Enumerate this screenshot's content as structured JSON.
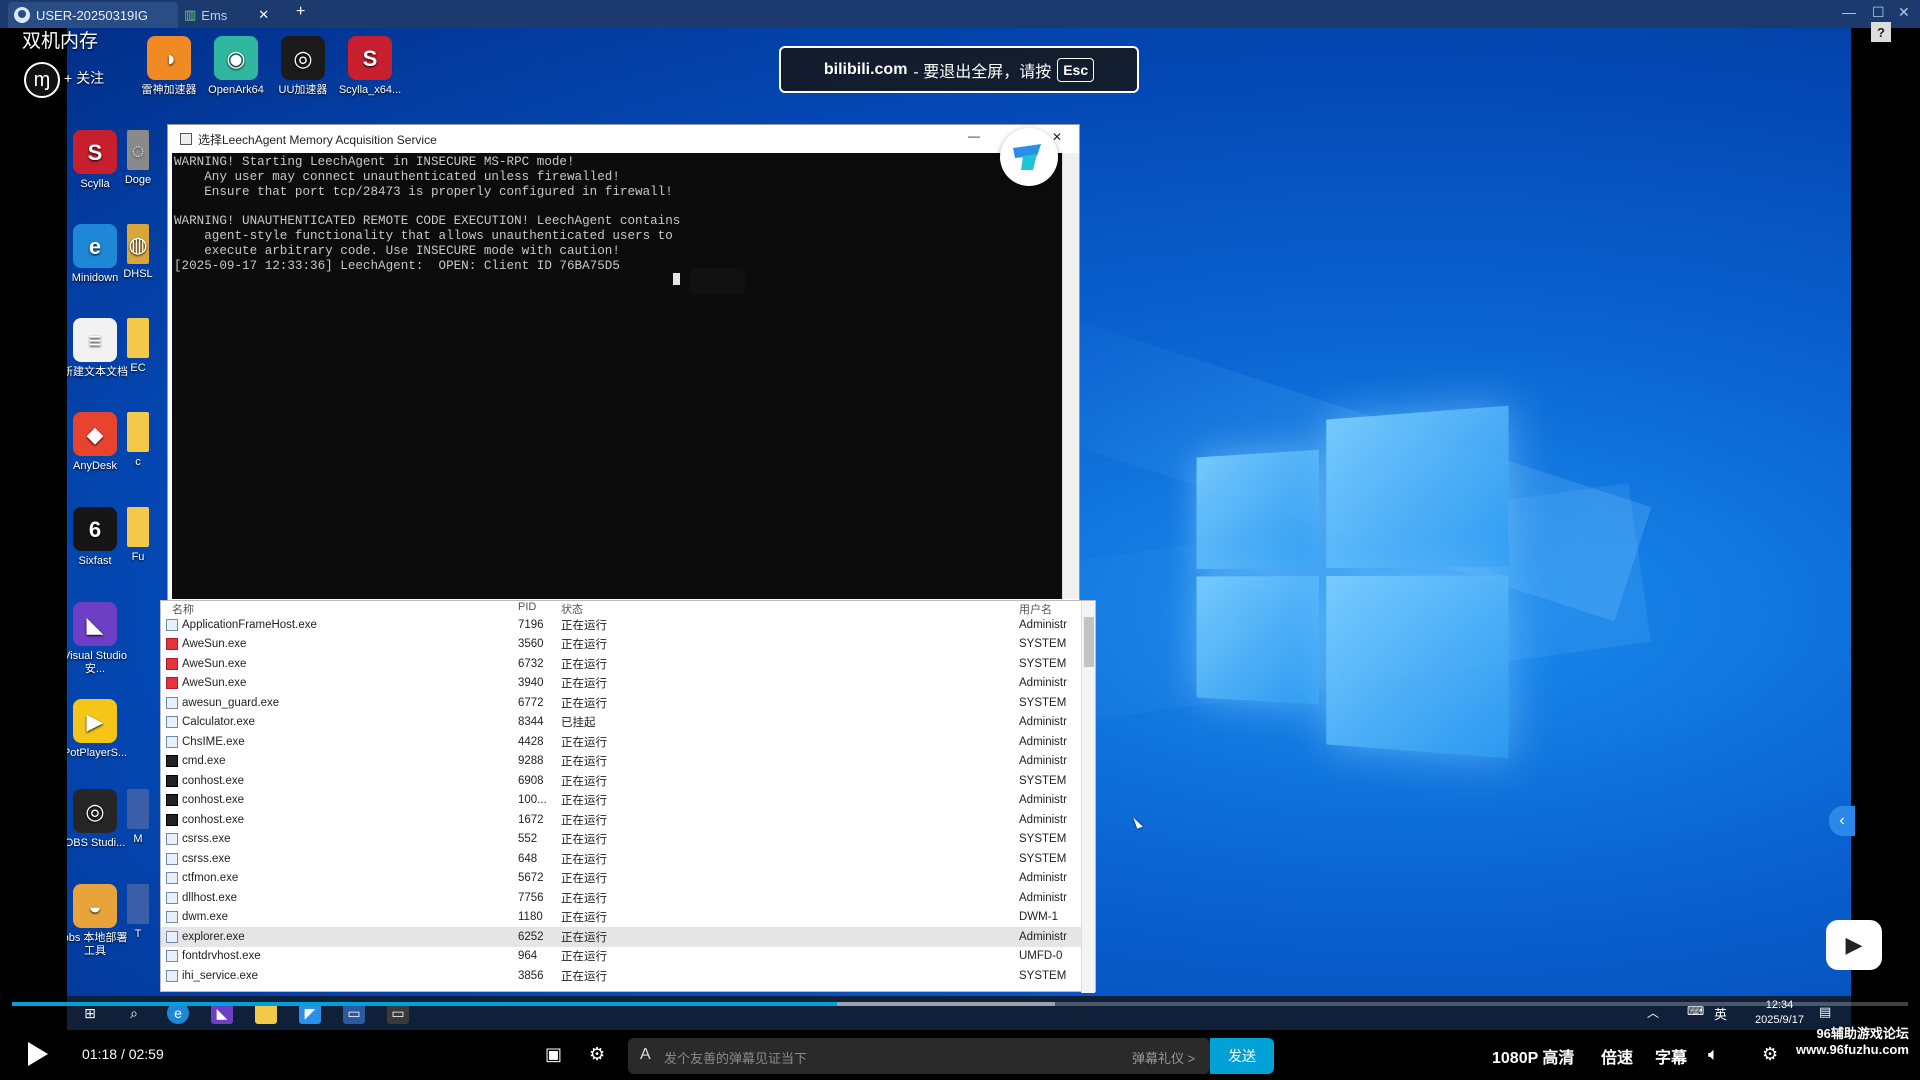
{
  "remote_tabs": [
    {
      "label": "USER-20250319IG"
    },
    {
      "label": "Ems"
    }
  ],
  "overlay": {
    "title": "双机内存",
    "follow": "+ 关注",
    "esc_banner": {
      "site": "bilibili.com",
      "text": "- 要退出全屏，请按",
      "key": "Esc"
    }
  },
  "desktop_icons": [
    {
      "label": "雷神加速器",
      "icon": "thunder-accelerator-icon",
      "color": "#f08a24",
      "glyph": "◑"
    },
    {
      "label": "OpenArk64",
      "icon": "openark-icon",
      "color": "#2fb7a0",
      "glyph": "◉"
    },
    {
      "label": "UU加速器",
      "icon": "uu-accelerator-icon",
      "color": "#1b1b1b",
      "glyph": "◎"
    },
    {
      "label": "Scylla_x64...",
      "icon": "scylla-icon",
      "color": "#c81f2e",
      "glyph": "S"
    },
    {
      "label": "Scylla",
      "icon": "scylla-icon",
      "color": "#c81f2e",
      "glyph": "S"
    },
    {
      "label": "Doge",
      "icon": "doge-icon",
      "color": "#8a8a8a",
      "glyph": "◌"
    },
    {
      "label": "Minidown",
      "icon": "edge-icon",
      "color": "#1e88d6",
      "glyph": "e"
    },
    {
      "label": "DHSL",
      "icon": "dhsl-icon",
      "color": "#d9a63a",
      "glyph": "◍"
    },
    {
      "label": "新建文本文档",
      "icon": "text-file-icon",
      "color": "#f2f2f2",
      "glyph": "≡"
    },
    {
      "label": "EC",
      "icon": "folder-icon",
      "color": "#f3c84b",
      "glyph": ""
    },
    {
      "label": "AnyDesk",
      "icon": "anydesk-icon",
      "color": "#e8432e",
      "glyph": "◆"
    },
    {
      "label": "c",
      "icon": "folder-icon",
      "color": "#f3c84b",
      "glyph": ""
    },
    {
      "label": "Sixfast",
      "icon": "sixfast-icon",
      "color": "#161616",
      "glyph": "6"
    },
    {
      "label": "Fu",
      "icon": "folder-icon",
      "color": "#f3c84b",
      "glyph": ""
    },
    {
      "label": "Visual Studio 安...",
      "icon": "visual-studio-icon",
      "color": "#6c3fc4",
      "glyph": "◣"
    },
    {
      "label": "PotPlayerS...",
      "icon": "potplayer-icon",
      "color": "#f5c518",
      "glyph": "▶"
    },
    {
      "label": "OBS Studi...",
      "icon": "obs-icon",
      "color": "#262626",
      "glyph": "◎"
    },
    {
      "label": "M",
      "icon": "app-icon",
      "color": "#3a5ea8",
      "glyph": ""
    },
    {
      "label": "obs 本地部署工具",
      "icon": "obs-deploy-icon",
      "color": "#e8a43a",
      "glyph": "◒"
    },
    {
      "label": "T",
      "icon": "app-icon",
      "color": "#3a5ea8",
      "glyph": ""
    }
  ],
  "console": {
    "title": "选择LeechAgent Memory Acquisition Service",
    "lines": [
      "WARNING! Starting LeechAgent in INSECURE MS-RPC mode!",
      "    Any user may connect unauthenticated unless firewalled!",
      "    Ensure that port tcp/28473 is properly configured in firewall!",
      "",
      "WARNING! UNAUTHENTICATED REMOTE CODE EXECUTION! LeechAgent contains",
      "    agent-style functionality that allows unauthenticated users to",
      "    execute arbitrary code. Use INSECURE mode with caution!",
      "[2025-09-17 12:33:36] LeechAgent:  OPEN: Client ID 76BA75D5"
    ]
  },
  "process_list": {
    "headers": {
      "name": "名称",
      "pid": "PID",
      "state": "状态",
      "user": "用户名"
    },
    "rows": [
      {
        "name": "ApplicationFrameHost.exe",
        "pid": "7196",
        "state": "正在运行",
        "user": "Administr",
        "icon": "app"
      },
      {
        "name": "AweSun.exe",
        "pid": "3560",
        "state": "正在运行",
        "user": "SYSTEM",
        "icon": "red"
      },
      {
        "name": "AweSun.exe",
        "pid": "6732",
        "state": "正在运行",
        "user": "SYSTEM",
        "icon": "red"
      },
      {
        "name": "AweSun.exe",
        "pid": "3940",
        "state": "正在运行",
        "user": "Administr",
        "icon": "red"
      },
      {
        "name": "awesun_guard.exe",
        "pid": "6772",
        "state": "正在运行",
        "user": "SYSTEM",
        "icon": "app"
      },
      {
        "name": "Calculator.exe",
        "pid": "8344",
        "state": "已挂起",
        "user": "Administr",
        "icon": "app"
      },
      {
        "name": "ChsIME.exe",
        "pid": "4428",
        "state": "正在运行",
        "user": "Administr",
        "icon": "app"
      },
      {
        "name": "cmd.exe",
        "pid": "9288",
        "state": "正在运行",
        "user": "Administr",
        "icon": "dark"
      },
      {
        "name": "conhost.exe",
        "pid": "6908",
        "state": "正在运行",
        "user": "SYSTEM",
        "icon": "dark"
      },
      {
        "name": "conhost.exe",
        "pid": "100...",
        "state": "正在运行",
        "user": "Administr",
        "icon": "dark"
      },
      {
        "name": "conhost.exe",
        "pid": "1672",
        "state": "正在运行",
        "user": "Administr",
        "icon": "dark"
      },
      {
        "name": "csrss.exe",
        "pid": "552",
        "state": "正在运行",
        "user": "SYSTEM",
        "icon": "app"
      },
      {
        "name": "csrss.exe",
        "pid": "648",
        "state": "正在运行",
        "user": "SYSTEM",
        "icon": "app"
      },
      {
        "name": "ctfmon.exe",
        "pid": "5672",
        "state": "正在运行",
        "user": "Administr",
        "icon": "app"
      },
      {
        "name": "dllhost.exe",
        "pid": "7756",
        "state": "正在运行",
        "user": "Administr",
        "icon": "app"
      },
      {
        "name": "dwm.exe",
        "pid": "1180",
        "state": "正在运行",
        "user": "DWM-1",
        "icon": "app"
      },
      {
        "name": "explorer.exe",
        "pid": "6252",
        "state": "正在运行",
        "user": "Administr",
        "icon": "app",
        "selected": true
      },
      {
        "name": "fontdrvhost.exe",
        "pid": "964",
        "state": "正在运行",
        "user": "UMFD-0",
        "icon": "app"
      },
      {
        "name": "ihi_service.exe",
        "pid": "3856",
        "state": "正在运行",
        "user": "SYSTEM",
        "icon": "app"
      }
    ]
  },
  "remote_taskbar": {
    "lang": "英",
    "time": "12:34",
    "date": "2025/9/17"
  },
  "player": {
    "current_time": "01:18",
    "total_time": "02:59",
    "progress": 0.435,
    "buffered": 0.55,
    "danmaku_placeholder": "发个友善的弹幕见证当下",
    "danmaku_etiquette": "弹幕礼仪 >",
    "send": "发送",
    "quality": "1080P 高清",
    "speed": "倍速",
    "subtitle": "字幕",
    "watermark_line1": "96辅助游戏论坛",
    "watermark_line2": "www.96fuzhu.com"
  },
  "colors": {
    "accent": "#00a1d6",
    "desktop": "#0a63d1"
  }
}
